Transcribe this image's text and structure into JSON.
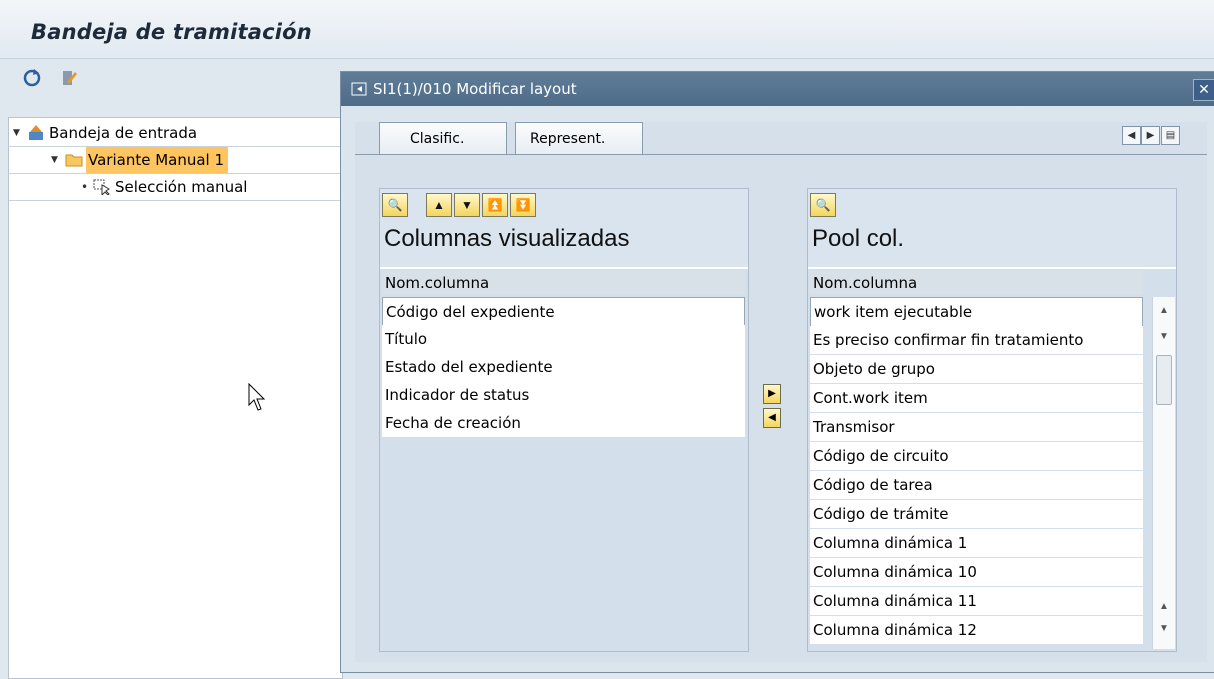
{
  "app": {
    "title": "Bandeja de tramitación"
  },
  "toolbar": {
    "icons": [
      "refresh-icon",
      "edit-icon"
    ]
  },
  "tree": {
    "items": [
      {
        "label": "Bandeja de entrada",
        "icon": "inbox-icon"
      },
      {
        "label": "Variante Manual 1",
        "icon": "folder-icon"
      },
      {
        "label": "Selección manual",
        "icon": "selection-icon"
      }
    ]
  },
  "dialog": {
    "title": "SI1(1)/010 Modificar layout",
    "tabs": [
      "Clasific.",
      "Represent."
    ],
    "left": {
      "title": "Columnas visualizadas",
      "col_header": "Nom.columna",
      "rows": [
        "Código del expediente",
        "Título",
        "Estado del expediente",
        "Indicador de status",
        "Fecha de creación"
      ]
    },
    "right": {
      "title": "Pool col.",
      "col_header": "Nom.columna",
      "rows": [
        "work item ejecutable",
        "Es preciso confirmar fin tratamiento",
        "Objeto de grupo",
        "Cont.work item",
        "Transmisor",
        "Código de circuito",
        "Código de tarea",
        "Código de trámite",
        "Columna dinámica 1",
        "Columna dinámica 10",
        "Columna dinámica 11",
        "Columna dinámica 12"
      ]
    }
  }
}
